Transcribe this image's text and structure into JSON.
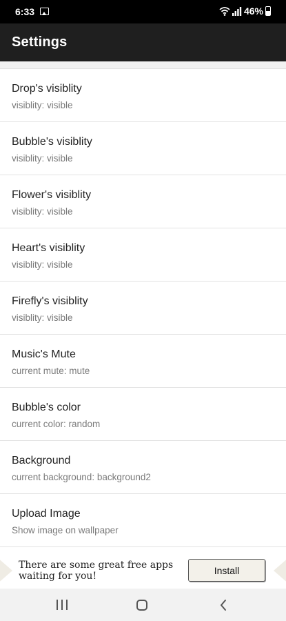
{
  "status_bar": {
    "time": "6:33",
    "battery": "46%",
    "icons": [
      "image-notification-icon",
      "wifi-icon",
      "signal-icon",
      "battery-icon"
    ]
  },
  "app_bar": {
    "title": "Settings"
  },
  "settings": [
    {
      "title": "Drop's visiblity",
      "subtitle": "visiblity: visible"
    },
    {
      "title": "Bubble's visiblity",
      "subtitle": "visiblity: visible"
    },
    {
      "title": "Flower's visiblity",
      "subtitle": "visiblity: visible"
    },
    {
      "title": "Heart's visiblity",
      "subtitle": "visiblity: visible"
    },
    {
      "title": "Firefly's visiblity",
      "subtitle": "visiblity: visible"
    },
    {
      "title": "Music's Mute",
      "subtitle": "current mute: mute"
    },
    {
      "title": "Bubble's color",
      "subtitle": "current color: random"
    },
    {
      "title": "Background",
      "subtitle": "current background: background2"
    },
    {
      "title": "Upload Image",
      "subtitle": "Show image on wallpaper"
    }
  ],
  "ad": {
    "text": "There are some great free apps waiting for you!",
    "install_label": "Install"
  },
  "nav_bar": {
    "icons": [
      "recent-apps-icon",
      "home-icon",
      "back-icon"
    ]
  },
  "colors": {
    "status_bar": "#000000",
    "app_bar": "#1f1f1f",
    "title_text": "#222222",
    "subtitle_text": "#7a7a7a",
    "divider": "#e2e2e2",
    "nav_bar": "#f2f2f2"
  }
}
